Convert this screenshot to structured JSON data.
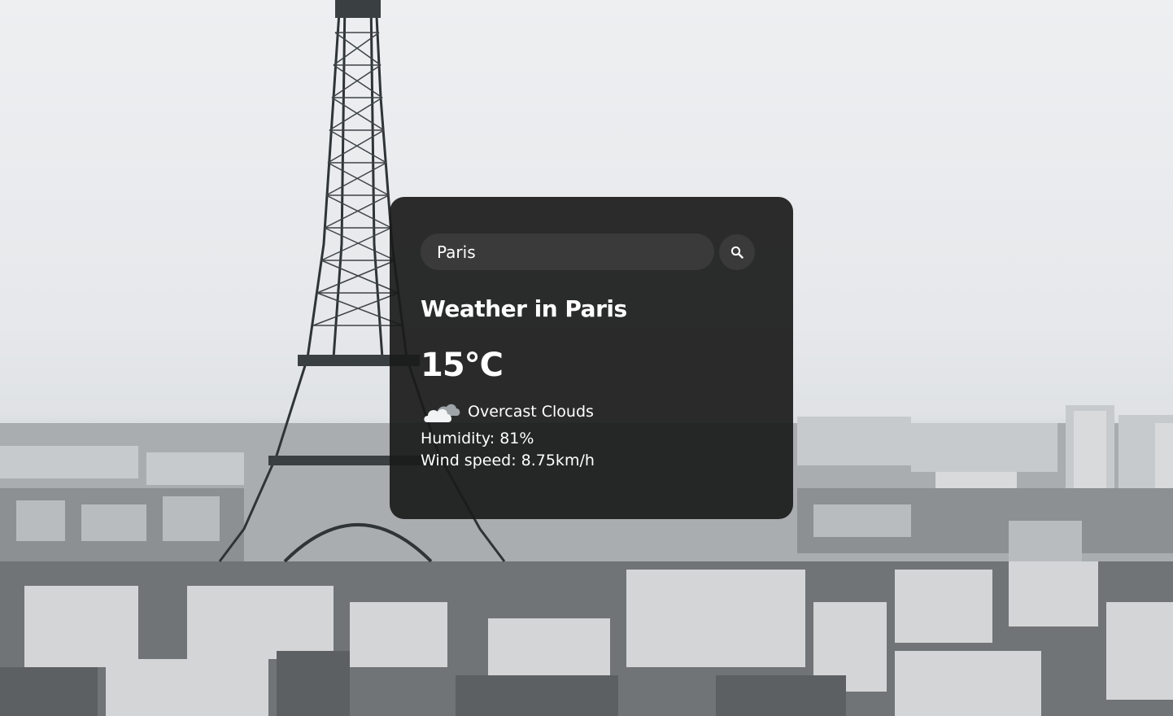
{
  "search": {
    "value": "Paris",
    "button_icon": "search-icon"
  },
  "weather": {
    "title": "Weather in Paris",
    "temperature": "15°C",
    "icon": "overcast-clouds-icon",
    "description": "Overcast Clouds",
    "humidity": "Humidity: 81%",
    "wind": "Wind speed: 8.75km/h"
  },
  "background": {
    "subject": "paris-skyline-photo"
  },
  "colors": {
    "card": "#1a1a1a",
    "input": "#3a3a3a",
    "text": "#ffffff"
  }
}
